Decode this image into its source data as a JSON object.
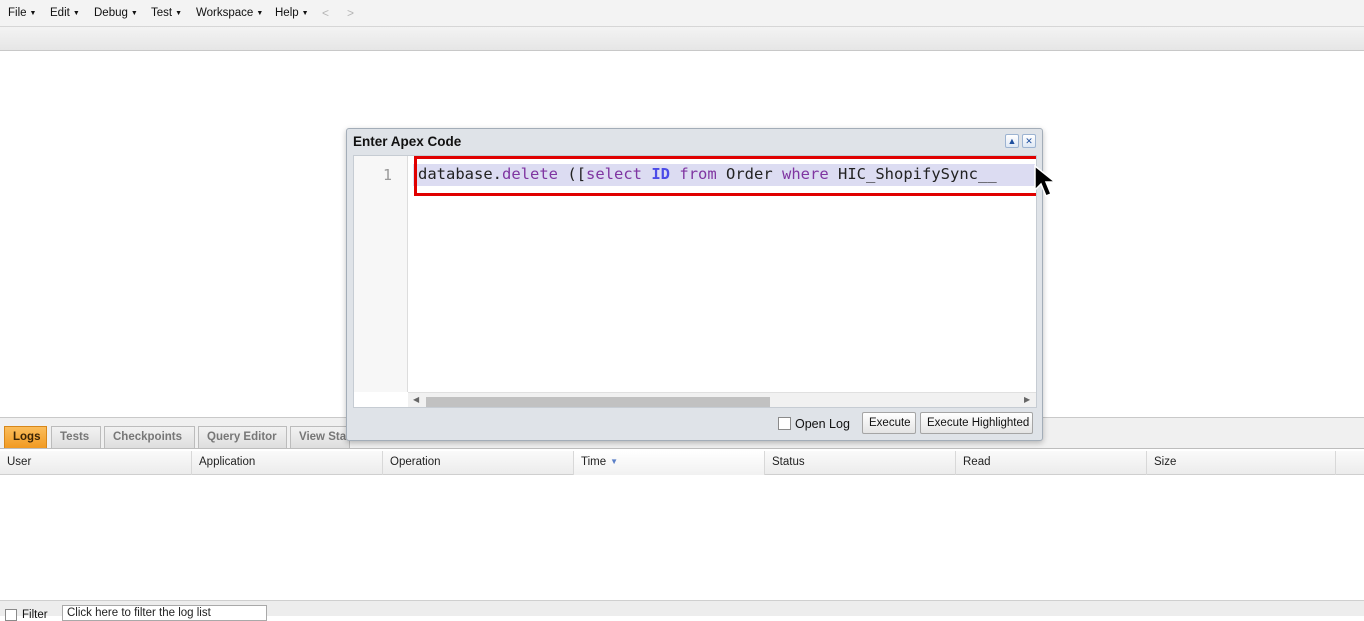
{
  "menu": {
    "items": [
      "File",
      "Edit",
      "Debug",
      "Test",
      "Workspace",
      "Help"
    ],
    "back_arrow": "<",
    "forward_arrow": ">"
  },
  "dialog": {
    "title": "Enter Apex Code",
    "editor": {
      "line_number": "1",
      "code_tokens": [
        {
          "text": "database.",
          "style": "plain"
        },
        {
          "text": "delete",
          "style": "kw"
        },
        {
          "text": " ([",
          "style": "plain"
        },
        {
          "text": "select",
          "style": "kw"
        },
        {
          "text": " ",
          "style": "plain"
        },
        {
          "text": "ID",
          "style": "kw-b"
        },
        {
          "text": " ",
          "style": "plain"
        },
        {
          "text": "from",
          "style": "kw"
        },
        {
          "text": " Order ",
          "style": "plain"
        },
        {
          "text": "where",
          "style": "kw"
        },
        {
          "text": " HIC_ShopifySync__",
          "style": "plain"
        }
      ]
    },
    "open_log_label": "Open Log",
    "execute_label": "Execute",
    "execute_highlighted_label": "Execute Highlighted"
  },
  "tabs": [
    "Logs",
    "Tests",
    "Checkpoints",
    "Query Editor",
    "View State"
  ],
  "active_tab": "Logs",
  "columns": [
    "User",
    "Application",
    "Operation",
    "Time",
    "Status",
    "Read",
    "Size"
  ],
  "sorted_column": "Time",
  "filter": {
    "label": "Filter",
    "placeholder": "Click here to filter the log list"
  },
  "colors": {
    "active_tab": "#f19a22",
    "highlight_box": "#e00000",
    "selection": "#dcdcf2"
  }
}
